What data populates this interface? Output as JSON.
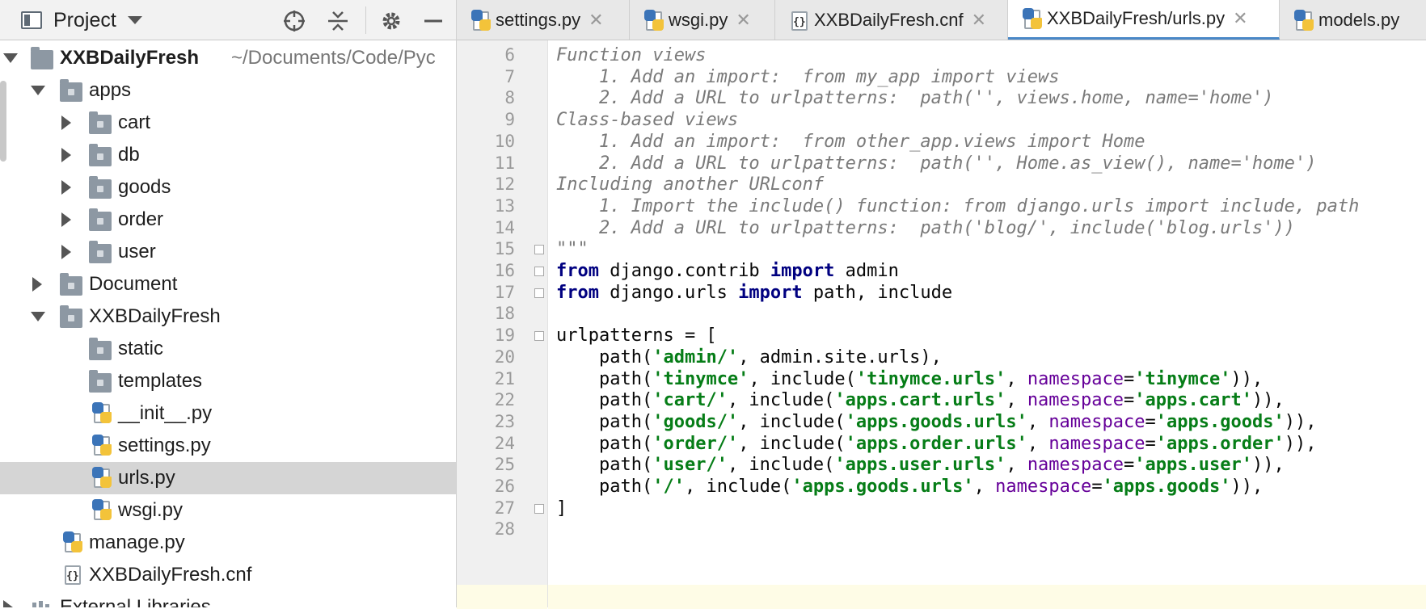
{
  "project_panel": {
    "title": "Project",
    "tree": [
      {
        "label": "XXBDailyFresh",
        "path": "~/Documents/Code/Pyc",
        "bold": true,
        "type": "root",
        "expanded": true
      },
      {
        "label": "apps",
        "type": "folder",
        "expanded": true
      },
      {
        "label": "cart",
        "type": "folder",
        "expanded": false
      },
      {
        "label": "db",
        "type": "folder",
        "expanded": false
      },
      {
        "label": "goods",
        "type": "folder",
        "expanded": false
      },
      {
        "label": "order",
        "type": "folder",
        "expanded": false
      },
      {
        "label": "user",
        "type": "folder",
        "expanded": false
      },
      {
        "label": "Document",
        "type": "folder",
        "expanded": false
      },
      {
        "label": "XXBDailyFresh",
        "type": "folder",
        "expanded": true
      },
      {
        "label": "static",
        "type": "folder"
      },
      {
        "label": "templates",
        "type": "folder"
      },
      {
        "label": "__init__.py",
        "type": "python"
      },
      {
        "label": "settings.py",
        "type": "python"
      },
      {
        "label": "urls.py",
        "type": "python",
        "selected": true
      },
      {
        "label": "wsgi.py",
        "type": "python"
      },
      {
        "label": "manage.py",
        "type": "python"
      },
      {
        "label": "XXBDailyFresh.cnf",
        "type": "config"
      },
      {
        "label": "External Libraries",
        "type": "library"
      }
    ]
  },
  "editor": {
    "tabs": [
      {
        "label": "settings.py",
        "icon": "python-file-icon"
      },
      {
        "label": "wsgi.py",
        "icon": "python-file-icon"
      },
      {
        "label": "XXBDailyFresh.cnf",
        "icon": "config-file-icon"
      },
      {
        "label": "XXBDailyFresh/urls.py",
        "icon": "python-file-icon",
        "active": true
      },
      {
        "label": "models.py",
        "icon": "python-file-icon"
      }
    ],
    "close_glyph": "✕",
    "lines": [
      {
        "n": "6",
        "text": "Function views"
      },
      {
        "n": "7",
        "text": "    1. Add an import:  from my_app import views"
      },
      {
        "n": "8",
        "text": "    2. Add a URL to urlpatterns:  path('', views.home, name='home')"
      },
      {
        "n": "9",
        "text": "Class-based views"
      },
      {
        "n": "10",
        "text": "    1. Add an import:  from other_app.views import Home"
      },
      {
        "n": "11",
        "text": "    2. Add a URL to urlpatterns:  path('', Home.as_view(), name='home')"
      },
      {
        "n": "12",
        "text": "Including another URLconf"
      },
      {
        "n": "13",
        "text": "    1. Import the include() function: from django.urls import include, path"
      },
      {
        "n": "14",
        "text": "    2. Add a URL to urlpatterns:  path('blog/', include('blog.urls'))"
      },
      {
        "n": "15",
        "text": "\"\"\""
      },
      {
        "n": "16",
        "text": "from django.contrib import admin"
      },
      {
        "n": "17",
        "text": "from django.urls import path, include"
      },
      {
        "n": "18",
        "text": ""
      },
      {
        "n": "19",
        "text": "urlpatterns = ["
      },
      {
        "n": "20",
        "text": "    path('admin/', admin.site.urls),"
      },
      {
        "n": "21",
        "text": "    path('tinymce', include('tinymce.urls', namespace='tinymce')),"
      },
      {
        "n": "22",
        "text": "    path('cart/', include('apps.cart.urls', namespace='apps.cart')),"
      },
      {
        "n": "23",
        "text": "    path('goods/', include('apps.goods.urls', namespace='apps.goods')),"
      },
      {
        "n": "24",
        "text": "    path('order/', include('apps.order.urls', namespace='apps.order')),"
      },
      {
        "n": "25",
        "text": "    path('user/', include('apps.user.urls', namespace='apps.user')),"
      },
      {
        "n": "26",
        "text": "    path('/', include('apps.goods.urls', namespace='apps.goods')),"
      },
      {
        "n": "27",
        "text": "]"
      },
      {
        "n": "28",
        "text": ""
      }
    ]
  },
  "colors": {
    "keyword": "#000080",
    "string": "#067d17",
    "comment": "#7a7a7a",
    "named_arg": "#660099",
    "accent": "#4a88c7"
  }
}
